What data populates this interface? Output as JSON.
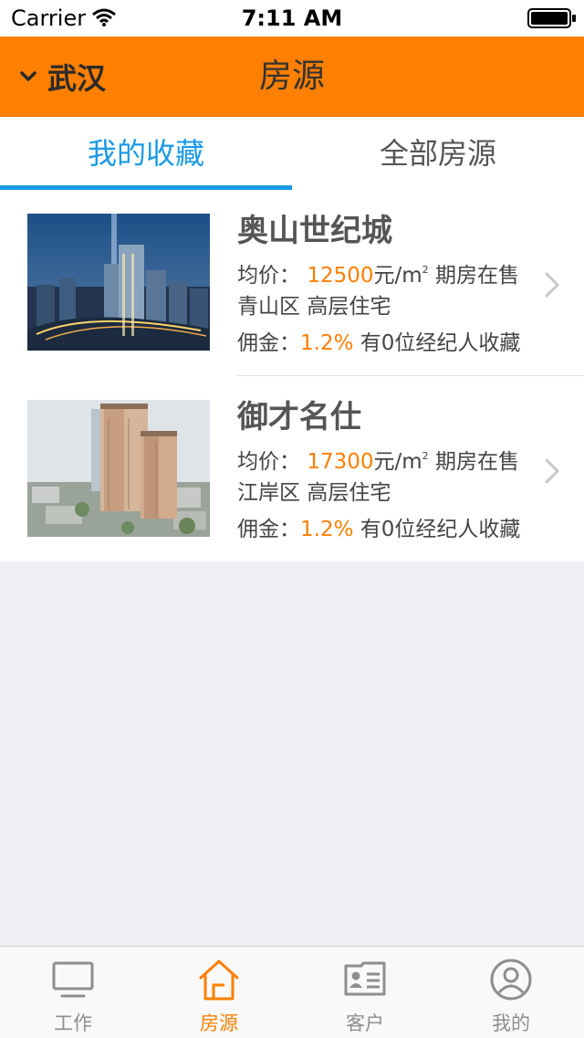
{
  "status_bar": {
    "carrier": "Carrier",
    "time": "7:11 AM"
  },
  "nav": {
    "city": "武汉",
    "title": "房源",
    "background_color": "#ff7f00"
  },
  "tabs": [
    {
      "label": "我的收藏",
      "active": true
    },
    {
      "label": "全部房源",
      "active": false
    }
  ],
  "accent_color": "#1a9ae6",
  "listings": [
    {
      "name": "奥山世纪城",
      "price_label": "均价：",
      "price_value": "12500",
      "price_unit": "元/m",
      "price_unit_sup": "2",
      "sale_status": "期房在售",
      "district": "青山区",
      "property_type": "高层住宅",
      "commission_label": "佣金：",
      "commission_value": "1.2%",
      "agents_text": "有0位经纪人收藏"
    },
    {
      "name": "御才名仕",
      "price_label": "均价：",
      "price_value": "17300",
      "price_unit": "元/m",
      "price_unit_sup": "2",
      "sale_status": "期房在售",
      "district": "江岸区",
      "property_type": "高层住宅",
      "commission_label": "佣金：",
      "commission_value": "1.2%",
      "agents_text": "有0位经纪人收藏"
    }
  ],
  "tab_bar": [
    {
      "label": "工作",
      "icon": "monitor-icon",
      "active": false
    },
    {
      "label": "房源",
      "icon": "house-icon",
      "active": true
    },
    {
      "label": "客户",
      "icon": "contact-card-icon",
      "active": false
    },
    {
      "label": "我的",
      "icon": "user-avatar-icon",
      "active": false
    }
  ]
}
